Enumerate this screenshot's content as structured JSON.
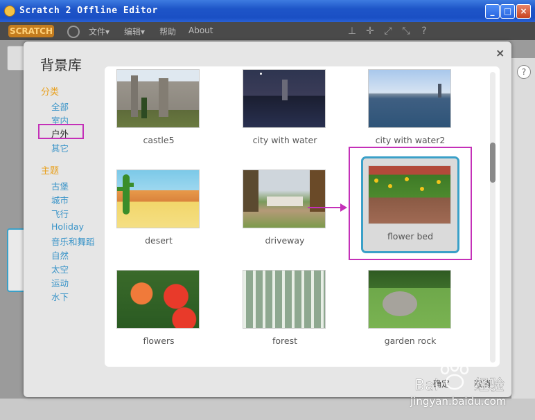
{
  "window": {
    "title": "Scratch 2 Offline Editor",
    "min_label": "_",
    "max_label": "□",
    "close_label": "×"
  },
  "menubar": {
    "logo": "SCRATCH",
    "items": [
      "文件▾",
      "编辑▾",
      "帮助",
      "About"
    ]
  },
  "modal": {
    "title": "背景库",
    "close": "×",
    "category_heading": "分类",
    "categories": [
      "全部",
      "室内",
      "户外",
      "其它"
    ],
    "selected_category": "户外",
    "theme_heading": "主题",
    "themes": [
      "古堡",
      "城市",
      "飞行",
      "Holiday",
      "音乐和舞蹈",
      "自然",
      "太空",
      "运动",
      "水下"
    ],
    "ok_label": "确定",
    "cancel_label": "取消"
  },
  "backdrops": [
    {
      "name": "castle5"
    },
    {
      "name": "city with water"
    },
    {
      "name": "city with water2"
    },
    {
      "name": "desert"
    },
    {
      "name": "driveway"
    },
    {
      "name": "flower bed",
      "selected": true
    },
    {
      "name": "flowers"
    },
    {
      "name": "forest"
    },
    {
      "name": "garden rock"
    }
  ],
  "watermark": {
    "text": "jingyan.baidu.com"
  },
  "colors": {
    "accent_blue": "#3aa0c8",
    "category_orange": "#e8a01e",
    "annotation_magenta": "#c430b8"
  }
}
